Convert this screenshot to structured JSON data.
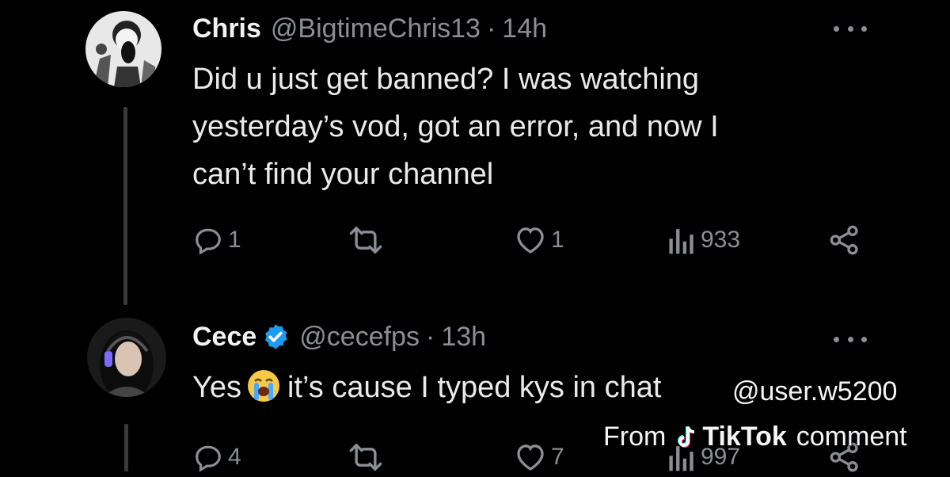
{
  "tweets": [
    {
      "name": "Chris",
      "handle": "@BigtimeChris13",
      "separator": "·",
      "time": "14h",
      "verified": false,
      "text_lines": [
        "Did u just get banned? I was watching",
        "yesterday’s vod, got an error, and now I",
        "can’t find your channel"
      ],
      "replies": "1",
      "retweets": "",
      "likes": "1",
      "views": "933",
      "icons": [
        "reply-icon",
        "retweet-icon",
        "like-icon",
        "views-icon",
        "share-icon",
        "more-icon"
      ]
    },
    {
      "name": "Cece",
      "handle": "@cecefps",
      "separator": "·",
      "time": "13h",
      "verified": true,
      "text_before_emoji": "Yes",
      "emoji": "loudly-crying-face",
      "text_after_emoji": "it’s cause I typed kys in chat",
      "replies": "4",
      "retweets": "",
      "likes": "7",
      "views": "997",
      "icons": [
        "reply-icon",
        "retweet-icon",
        "like-icon",
        "views-icon",
        "share-icon",
        "more-icon",
        "verified-badge-icon"
      ]
    }
  ],
  "watermark": {
    "username": "@user.w5200",
    "from": "From",
    "brand": "TikTok",
    "suffix": "comment"
  },
  "colors": {
    "background": "#000000",
    "text": "#e7e9ea",
    "muted": "#8b8f94",
    "verified": "#1d9bf0",
    "thread_line": "#3a3a3a"
  }
}
